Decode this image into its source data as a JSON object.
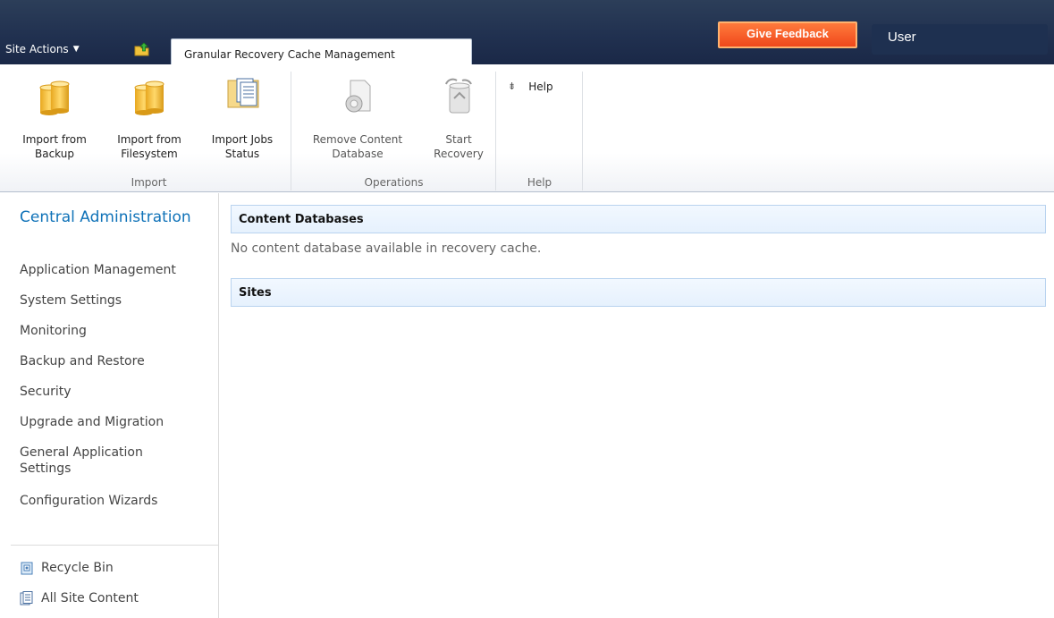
{
  "topbar": {
    "site_actions": "Site Actions",
    "active_tab": "Granular Recovery Cache Management",
    "feedback": "Give Feedback",
    "user": "User",
    "accent": "#f0481b"
  },
  "ribbon": {
    "import": {
      "label": "Import",
      "buttons": [
        {
          "line1": "Import from",
          "line2": "Backup",
          "icon": "database-icon"
        },
        {
          "line1": "Import from",
          "line2": "Filesystem",
          "icon": "database-icon"
        },
        {
          "line1": "Import Jobs",
          "line2": "Status",
          "icon": "job-status-icon"
        }
      ]
    },
    "operations": {
      "label": "Operations",
      "buttons": [
        {
          "line1": "Remove Content",
          "line2": "Database",
          "icon": "remove-database-icon"
        },
        {
          "line1": "Start",
          "line2": "Recovery",
          "icon": "start-recovery-icon"
        }
      ]
    },
    "help": {
      "label": "Help",
      "button": "Help"
    }
  },
  "leftnav": {
    "home": "Central Administration",
    "items": [
      "Application Management",
      "System Settings",
      "Monitoring",
      "Backup and Restore",
      "Security",
      "Upgrade and Migration",
      "General Application Settings",
      "Configuration Wizards"
    ],
    "recycle_bin": "Recycle Bin",
    "all_site_content": "All Site Content"
  },
  "main": {
    "content_databases": {
      "title": "Content Databases",
      "empty": "No content database available in recovery cache."
    },
    "sites": {
      "title": "Sites"
    }
  }
}
